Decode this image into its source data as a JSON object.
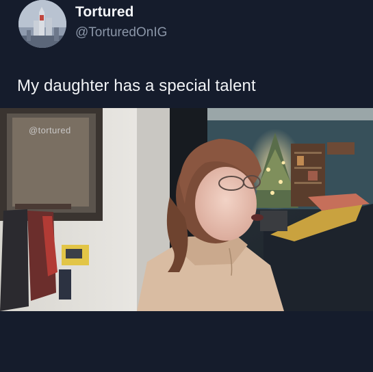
{
  "post": {
    "author_name": "Tortured",
    "author_handle": "@TorturedOnIG",
    "text": "My daughter has a special talent"
  },
  "media": {
    "watermark": "@tortured"
  },
  "colors": {
    "background": "#151c2c",
    "name": "#f3f5f8",
    "handle": "#8b96a8"
  }
}
